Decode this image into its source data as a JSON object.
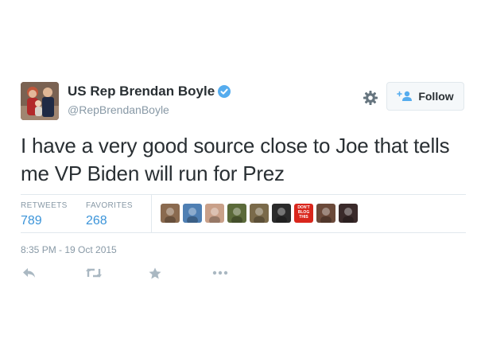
{
  "user": {
    "display_name": "US Rep Brendan Boyle",
    "handle": "@RepBrendanBoyle",
    "verified": true
  },
  "follow_button": {
    "label": "Follow"
  },
  "tweet": {
    "text": "I have a very good source close to Joe that tells me VP Biden will run for Prez",
    "timestamp": "8:35 PM - 19 Oct 2015"
  },
  "stats": {
    "retweets_label": "RETWEETS",
    "retweets_count": "789",
    "favorites_label": "FAVORITES",
    "favorites_count": "268"
  },
  "favoriters": [
    {
      "color": "#8a6a4f"
    },
    {
      "color": "#4f7fb3"
    },
    {
      "color": "#c9a089"
    },
    {
      "color": "#5b6a3a"
    },
    {
      "color": "#7a6a4a"
    },
    {
      "color": "#2b2b2b"
    },
    {
      "color": "#d9261c",
      "text": "DON'T BLOG THIS"
    },
    {
      "color": "#6b4a3a"
    },
    {
      "color": "#3a2a2a"
    }
  ],
  "actions": [
    "reply-icon",
    "retweet-icon",
    "favorite-icon",
    "more-icon"
  ],
  "colors": {
    "link_blue": "#3b94d9",
    "verified_blue": "#55acee",
    "muted_text": "#8899a6",
    "action_grey": "#aab8c2"
  }
}
